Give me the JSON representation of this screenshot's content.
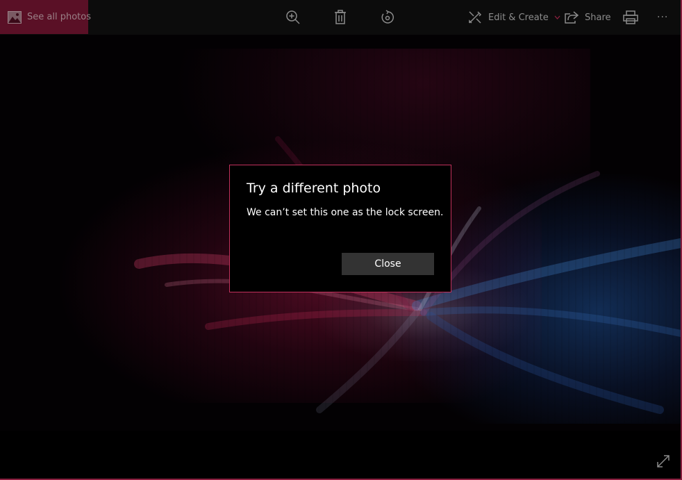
{
  "toolbar": {
    "see_all_label": "See all photos",
    "zoom_icon": "zoom-in-icon",
    "delete_icon": "trash-icon",
    "rotate_icon": "rotate-icon",
    "edit_label": "Edit & Create",
    "share_label": "Share",
    "print_icon": "printer-icon",
    "more_label": "···"
  },
  "dialog": {
    "title": "Try a different photo",
    "message": "We can’t set this one as the lock screen.",
    "close_label": "Close"
  },
  "colors": {
    "accent": "#c2315c",
    "see_all_bg": "#5a1026",
    "button_bg": "#333333",
    "toolbar_text": "#8c8c8c"
  }
}
